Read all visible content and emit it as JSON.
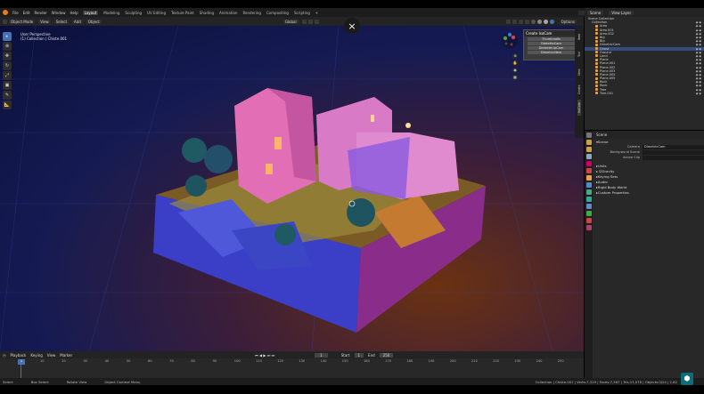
{
  "menubar": {
    "menus": [
      "File",
      "Edit",
      "Render",
      "Window",
      "Help"
    ],
    "workspaces": [
      "Layout",
      "Modeling",
      "Sculpting",
      "UV Editing",
      "Texture Paint",
      "Shading",
      "Animation",
      "Rendering",
      "Compositing",
      "Scripting"
    ],
    "active_workspace": "Layout",
    "scene": "Scene",
    "view_layer": "View Layer"
  },
  "viewport_header": {
    "mode": "Object Mode",
    "menus": [
      "View",
      "Select",
      "Add",
      "Object"
    ],
    "transform": "Global",
    "options": "Options"
  },
  "viewport_info": {
    "line1": "User Perspective",
    "line2": "(1) Collection | Chiste.001"
  },
  "close_button": "×",
  "popup": {
    "title": "Create IsoCam",
    "options": [
      "Thumbnails",
      "DietetteCam",
      "DietetteUpCam",
      "DimetricNew"
    ]
  },
  "n_tabs": [
    "Item",
    "Tool",
    "View",
    "Create",
    "Animation",
    "Edit",
    "View 1",
    "IsoCam",
    "Screencast Keys"
  ],
  "outliner": {
    "root": "Scene Collection",
    "rows": [
      "Collection",
      "Area",
      "Area.001",
      "Area.002",
      "Big",
      "Big",
      "DimetricCam",
      "Ghost",
      "Ground",
      "Land",
      "Plane",
      "Plane.001",
      "Plane.002",
      "Plane.003",
      "Plane.004",
      "Plane.005",
      "Rock",
      "Rock",
      "Tree",
      "Tree.001"
    ]
  },
  "properties": {
    "title": "Scene",
    "section": "Scene",
    "camera_label": "Camera",
    "camera_value": "DimetricCam",
    "bg_scene_label": "Background Scene",
    "active_clip_label": "Active Clip",
    "panels": [
      "Units",
      "Gravity",
      "Keying Sets",
      "Audio",
      "Rigid Body World",
      "Custom Properties"
    ]
  },
  "timeline": {
    "menus": [
      "Playback",
      "Keying",
      "View",
      "Marker"
    ],
    "current_frame": "1",
    "start_label": "Start",
    "start": "1",
    "end_label": "End",
    "end": "250",
    "ticks": [
      "10",
      "20",
      "30",
      "40",
      "50",
      "60",
      "70",
      "80",
      "90",
      "100",
      "110",
      "120",
      "130",
      "140",
      "150",
      "160",
      "170",
      "180",
      "190",
      "200",
      "210",
      "220",
      "230",
      "240",
      "250"
    ]
  },
  "statusbar": {
    "select": "Select",
    "box_select": "Box Select",
    "rotate_view": "Rotate View",
    "context_menu": "Object Context Menu",
    "stats": "Collection | Chiste.001 | Verts:7,319 | Faces:7,367 | Tris:13,076 | Objects:0/24 | 2.82"
  },
  "colors": {
    "accent": "#4772b3",
    "orange": "#e87d0d",
    "selection": "#334d80"
  }
}
